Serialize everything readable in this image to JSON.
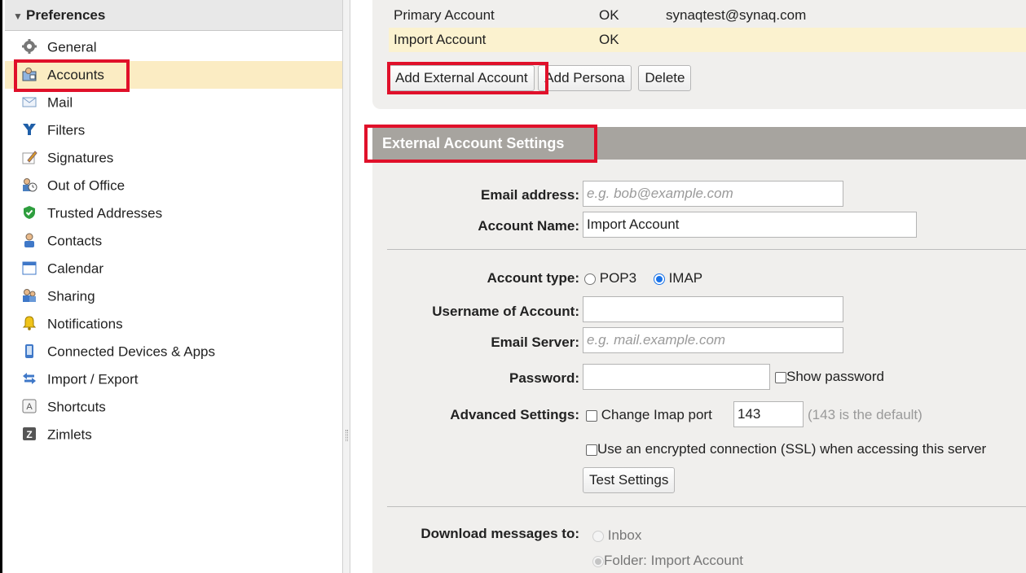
{
  "sidebar": {
    "header": "Preferences",
    "items": [
      {
        "label": "General",
        "icon": "gear-icon"
      },
      {
        "label": "Accounts",
        "icon": "accounts-icon"
      },
      {
        "label": "Mail",
        "icon": "envelope-icon"
      },
      {
        "label": "Filters",
        "icon": "filter-icon"
      },
      {
        "label": "Signatures",
        "icon": "signature-icon"
      },
      {
        "label": "Out of Office",
        "icon": "out-of-office-icon"
      },
      {
        "label": "Trusted Addresses",
        "icon": "shield-check-icon"
      },
      {
        "label": "Contacts",
        "icon": "contact-person-icon"
      },
      {
        "label": "Calendar",
        "icon": "calendar-icon"
      },
      {
        "label": "Sharing",
        "icon": "sharing-icon"
      },
      {
        "label": "Notifications",
        "icon": "bell-icon"
      },
      {
        "label": "Connected Devices & Apps",
        "icon": "device-icon"
      },
      {
        "label": "Import / Export",
        "icon": "import-export-icon"
      },
      {
        "label": "Shortcuts",
        "icon": "keyboard-key-icon"
      },
      {
        "label": "Zimlets",
        "icon": "zimlet-icon"
      }
    ],
    "selected": "Accounts"
  },
  "accounts": {
    "rows": [
      {
        "name": "Primary Account",
        "status": "OK",
        "email": "synaqtest@synaq.com"
      },
      {
        "name": "Import Account",
        "status": "OK",
        "email": ""
      }
    ],
    "buttons": {
      "add_external": "Add External Account",
      "add_persona": "Add Persona",
      "delete": "Delete"
    }
  },
  "settings": {
    "header": "External Account Settings",
    "email_label": "Email address:",
    "email_placeholder": "e.g. bob@example.com",
    "account_name_label": "Account Name:",
    "account_name_value": "Import Account",
    "account_type_label": "Account type:",
    "account_type_options": [
      "POP3",
      "IMAP"
    ],
    "account_type_selected": "IMAP",
    "username_label": "Username of Account:",
    "username_value": "",
    "server_label": "Email Server:",
    "server_placeholder": "e.g. mail.example.com",
    "password_label": "Password:",
    "show_password_label": "Show password",
    "advanced_label": "Advanced Settings:",
    "change_port_label": "Change Imap port",
    "port_value": "143",
    "port_hint": "(143 is the default)",
    "ssl_label": "Use an encrypted connection (SSL) when accessing this server",
    "test_button": "Test Settings",
    "download_label": "Download messages to:",
    "download_options": [
      "Inbox",
      "Folder: Import Account"
    ],
    "download_selected": "Folder: Import Account"
  },
  "colors": {
    "highlight_red": "#e0102a",
    "selected_row": "#fbecc3",
    "header_gray": "#a7a49f",
    "panel_bg": "#f0efed"
  }
}
